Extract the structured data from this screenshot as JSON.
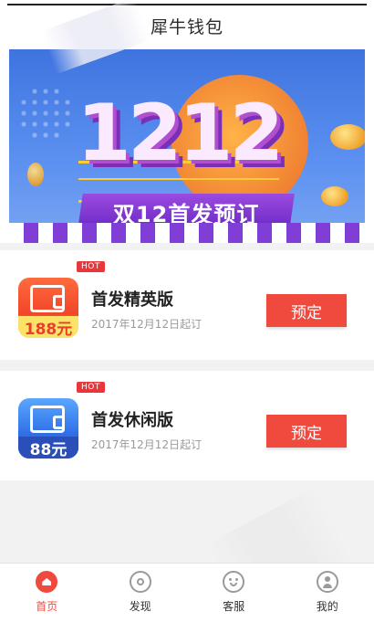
{
  "header": {
    "title": "犀牛钱包"
  },
  "banner": {
    "big_text": "1212",
    "ribbon_text": "双12首发预订"
  },
  "products": [
    {
      "badge": "HOT",
      "icon_price": "188元",
      "name": "首发精英版",
      "date": "2017年12月12日起订",
      "button": "预定",
      "icon_color": "#f2452a"
    },
    {
      "badge": "HOT",
      "icon_price": "88元",
      "name": "首发休闲版",
      "date": "2017年12月12日起订",
      "button": "预定",
      "icon_color": "#2f6fe6"
    }
  ],
  "tabbar": {
    "items": [
      {
        "label": "首页",
        "icon": "home-icon",
        "active": true
      },
      {
        "label": "发现",
        "icon": "eye-icon",
        "active": false
      },
      {
        "label": "客服",
        "icon": "customer-service-icon",
        "active": false
      },
      {
        "label": "我的",
        "icon": "user-icon",
        "active": false
      }
    ]
  },
  "colors": {
    "accent": "#f04a3e",
    "hot_badge": "#e8373b"
  }
}
